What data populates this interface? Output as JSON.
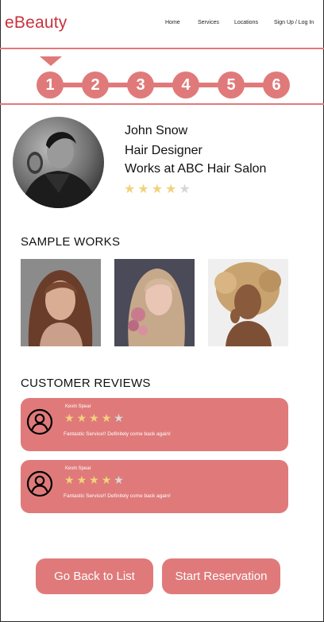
{
  "header": {
    "logo": "eBeauty",
    "nav": {
      "home": "Home",
      "services": "Services",
      "locations": "Locations",
      "signup": "Sign Up / Log In"
    }
  },
  "stepper": {
    "steps": [
      "1",
      "2",
      "3",
      "4",
      "5",
      "6"
    ],
    "current": 1
  },
  "profile": {
    "name": "John Snow",
    "role": "Hair Designer",
    "workplace": "Works at ABC Hair Salon",
    "rating": 4,
    "max_rating": 5
  },
  "sample_works": {
    "title": "SAMPLE WORKS"
  },
  "reviews": {
    "title": "CUSTOMER REVIEWS",
    "items": [
      {
        "name": "Kevin Spear",
        "rating": 4,
        "max_rating": 5,
        "text": "Fantastic Service!! Definitely come back again!"
      },
      {
        "name": "Kevin Spear",
        "rating": 4,
        "max_rating": 5,
        "text": "Fantastic Service!! Definitely come back again!"
      }
    ]
  },
  "buttons": {
    "back": "Go Back to List",
    "reserve": "Start Reservation"
  },
  "colors": {
    "brand": "#c8323c",
    "accent": "#e07a7a",
    "star_filled": "#f2d27c",
    "star_empty": "#d6d6d6"
  }
}
